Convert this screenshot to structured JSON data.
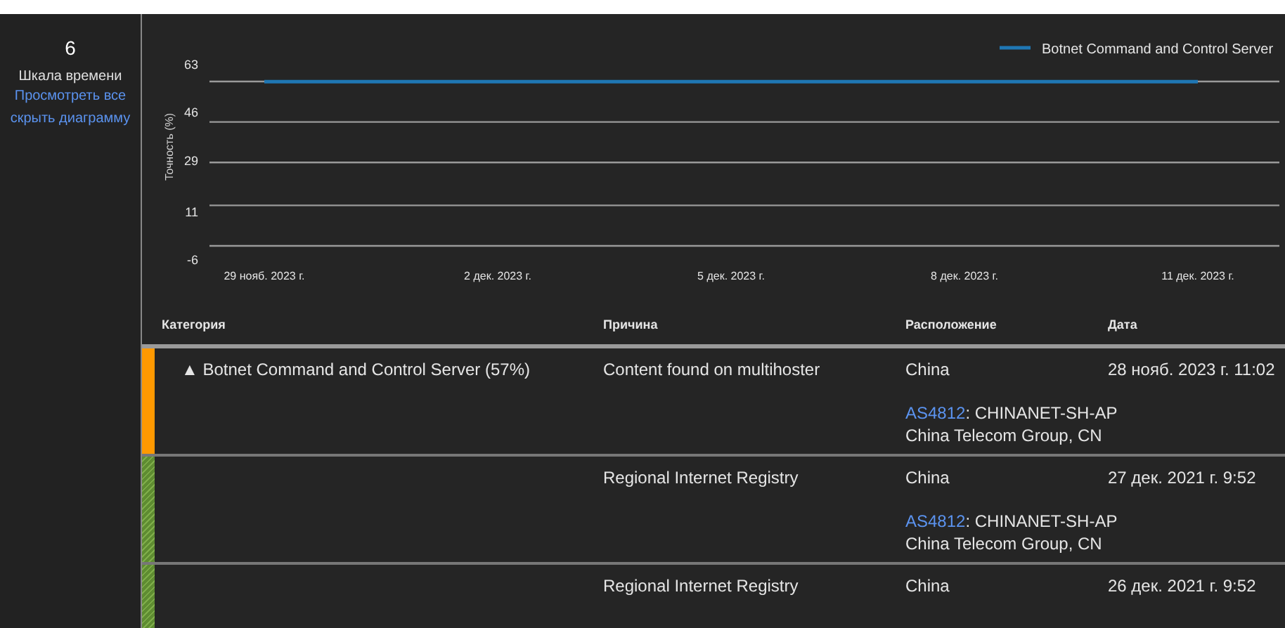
{
  "side_panel": {
    "count": "6",
    "caption": "Шкала времени",
    "links": [
      "Просмотреть все",
      "скрыть диаграмму"
    ]
  },
  "chart": {
    "chart_data": {
      "type": "line",
      "ylabel": "Точность (%)",
      "ylim": [
        -6,
        63
      ],
      "yticks": [
        63,
        46,
        29,
        11,
        -6
      ],
      "categories": [
        "29 нояб. 2023 г.",
        "2 дек. 2023 г.",
        "5 дек. 2023 г.",
        "8 дек. 2023 г.",
        "11 дек. 2023 г."
      ],
      "series": [
        {
          "name": "Botnet Command and Control Server",
          "color": "#1f77b4",
          "values": [
            57,
            57,
            57,
            57,
            57
          ]
        }
      ]
    }
  },
  "table": {
    "columns": [
      "Категория",
      "Причина",
      "Расположение",
      "Дата"
    ],
    "rows": [
      {
        "color": "#ff9900",
        "striped": false,
        "category": "▲ Botnet Command and Control Server (57%)",
        "reason": "Content found on multihoster",
        "location": "China",
        "asn": "AS4812",
        "network": ": CHINANET-SH-AP",
        "owner": "China Telecom Group, CN",
        "date": "28 нояб. 2023 г. 11:02"
      },
      {
        "color": "#5e8c31",
        "striped": true,
        "reason": "Regional Internet Registry",
        "location": "China",
        "asn": "AS4812",
        "network": ": CHINANET-SH-AP",
        "owner": "China Telecom Group, CN",
        "date": "27 дек. 2021 г. 9:52"
      },
      {
        "color": "#5e8c31",
        "striped": true,
        "reason": "Regional Internet Registry",
        "location": "China",
        "date": "26 дек. 2021 г. 9:52"
      }
    ]
  }
}
